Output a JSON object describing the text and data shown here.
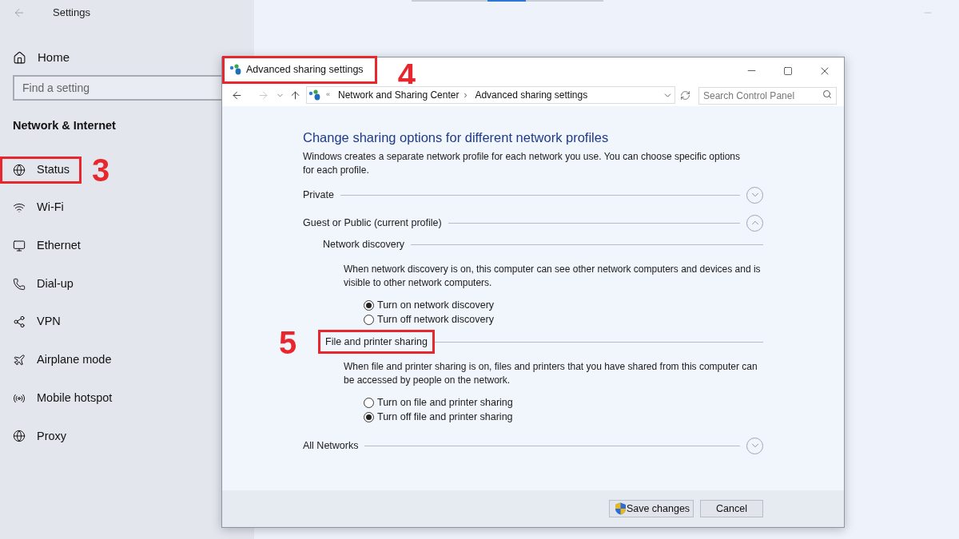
{
  "settings": {
    "title": "Settings",
    "home": "Home",
    "search": {
      "placeholder": "Find a setting"
    },
    "section": "Network & Internet",
    "items": [
      {
        "label": "Status",
        "annotation": "3"
      },
      {
        "label": "Wi-Fi"
      },
      {
        "label": "Ethernet"
      },
      {
        "label": "Dial-up"
      },
      {
        "label": "VPN"
      },
      {
        "label": "Airplane mode"
      },
      {
        "label": "Mobile hotspot"
      },
      {
        "label": "Proxy"
      }
    ]
  },
  "dialog": {
    "title": "Advanced sharing settings",
    "annotation": "4",
    "breadcrumb_prefix": "«",
    "breadcrumb": [
      {
        "text": "Network and Sharing Center"
      },
      {
        "separator": "›",
        "text": "Advanced sharing settings"
      }
    ],
    "search": {
      "placeholder": "Search Control Panel"
    },
    "heading": "Change sharing options for different network profiles",
    "intro": "Windows creates a separate network profile for each network you use. You can choose specific options for each profile.",
    "profiles": [
      {
        "name": "Private",
        "expanded": false
      },
      {
        "name": "Guest or Public (current profile)",
        "expanded": true,
        "groups": [
          {
            "title": "Network discovery",
            "description": "When network discovery is on, this computer can see other network computers and devices and is visible to other network computers.",
            "options": [
              {
                "label": "Turn on network discovery",
                "selected": true
              },
              {
                "label": "Turn off network discovery",
                "selected": false
              }
            ]
          },
          {
            "title": "File and printer sharing",
            "annotation": "5",
            "description": "When file and printer sharing is on, files and printers that you have shared from this computer can be accessed by people on the network.",
            "options": [
              {
                "label": "Turn on file and printer sharing",
                "selected": false
              },
              {
                "label": "Turn off file and printer sharing",
                "selected": true
              }
            ]
          }
        ]
      },
      {
        "name": "All Networks",
        "expanded": false
      }
    ],
    "buttons": [
      {
        "label": "Save changes",
        "kind": "shield"
      },
      {
        "label": "Cancel",
        "kind": "plain"
      }
    ]
  }
}
